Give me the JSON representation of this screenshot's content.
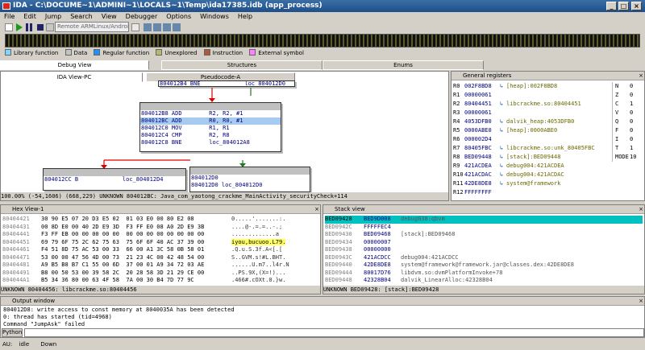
{
  "window": {
    "title": "IDA - C:\\DOCUME~1\\ADMINI~1\\LOCALS~1\\Temp\\ida17385.idb (app_process)"
  },
  "menu": [
    "File",
    "Edit",
    "Jump",
    "Search",
    "View",
    "Debugger",
    "Options",
    "Windows",
    "Help"
  ],
  "toolbar": {
    "debugger": "Remote ARMLinux/Android debugger"
  },
  "legend": [
    {
      "label": "Library function",
      "color": "#7fd7ff"
    },
    {
      "label": "Data",
      "color": "#c4c4c4"
    },
    {
      "label": "Regular function",
      "color": "#1e90ff"
    },
    {
      "label": "Unexplored",
      "color": "#b8b870"
    },
    {
      "label": "Instruction",
      "color": "#b05a3a"
    },
    {
      "label": "External symbol",
      "color": "#ff80ff"
    }
  ],
  "tabs": {
    "debug_view": "Debug View",
    "structures": "Structures",
    "enums": "Enums",
    "ida_view": "IDA View-PC",
    "pseudocode": "Pseudocode-A"
  },
  "graph": {
    "top_node": "804012B4 BNE             loc_804012D0",
    "main_node": [
      "804012B8 ADD        R2, R2, #1",
      "804012BC ADD        R0, R0, #1",
      "804012C0 MOV        R1, R1",
      "804012C4 CMP        R2, R8",
      "804012C8 BNE        loc_804012A8"
    ],
    "left_node": "804012CC B             loc_804012D4",
    "right_node": [
      "804012D0",
      "804012D0 loc_804012D0"
    ],
    "status": "100.00% (-54,1606) (668,229) UNKNOWN 804012BC: Java_com_yaotong_crackme_MainActivity_securityCheck+114"
  },
  "registers": {
    "title": "General registers",
    "rows": [
      {
        "name": "R0",
        "value": "002F8BD8",
        "desc": "[heap]:002F8BD8"
      },
      {
        "name": "R1",
        "value": "00000061",
        "desc": ""
      },
      {
        "name": "R2",
        "value": "80404451",
        "desc": "libcrackme.so:80404451"
      },
      {
        "name": "R3",
        "value": "00000061",
        "desc": ""
      },
      {
        "name": "R4",
        "value": "4053DFB0",
        "desc": "dalvik_heap:4053DFB0"
      },
      {
        "name": "R5",
        "value": "0000ABE0",
        "desc": "[heap]:0000ABE0"
      },
      {
        "name": "R6",
        "value": "000002D4",
        "desc": ""
      },
      {
        "name": "R7",
        "value": "80405FBC",
        "desc": "libcrackme.so:unk_80405FBC"
      },
      {
        "name": "R8",
        "value": "BED09448",
        "desc": "[stack]:BED09448"
      },
      {
        "name": "R9",
        "value": "421ACDEA",
        "desc": "debug004:421ACDEA"
      },
      {
        "name": "R10",
        "value": "421ACDAC",
        "desc": "debug004:421ACDAC"
      },
      {
        "name": "R11",
        "value": "42DE8DE8",
        "desc": "system@framework"
      },
      {
        "name": "R12",
        "value": "FFFFFFFF",
        "desc": ""
      }
    ],
    "flags": [
      {
        "name": "N",
        "value": "0"
      },
      {
        "name": "Z",
        "value": "0"
      },
      {
        "name": "C",
        "value": "1"
      },
      {
        "name": "V",
        "value": "0"
      },
      {
        "name": "Q",
        "value": "0"
      },
      {
        "name": "F",
        "value": "0"
      },
      {
        "name": "I",
        "value": "0"
      },
      {
        "name": "T",
        "value": "1"
      },
      {
        "name": "MODE",
        "value": "10"
      }
    ]
  },
  "hex": {
    "title": "Hex View-1",
    "rows": [
      {
        "addr": "80404421",
        "bytes": "30 90 E5 07 20 D3 E5 02  01 03 E0 00 80 E2 08",
        "ascii": "0.....'.......:."
      },
      {
        "addr": "80404431",
        "bytes": "00 8D E0 00 40 2D E9 3D  F3 FF E0 08 A0 2D E9 3B",
        "ascii": "....@-.=.=..-.;"
      },
      {
        "addr": "80404441",
        "bytes": "F3 FF EB 00 00 00 00 00  00 00 00 00 00 00 00 00",
        "ascii": ".............a"
      },
      {
        "addr": "80404451",
        "bytes": "69 79 6F 75 2C 62 75 63  75 6F 6F 40 AC 37 39 00",
        "ascii": "iyou,bucuoo.L79.",
        "hl": true
      },
      {
        "addr": "80404461",
        "bytes": "F4 51 8D 75 AC 53 00 33  66 00 A1 3C 58 0B 58 01",
        "ascii": ".Q.u.S.3f.A<[.["
      },
      {
        "addr": "80404471",
        "bytes": "53 00 00 47 56 4D 00 73  21 23 4C 00 42 48 54 00",
        "ascii": "S..GVM.s!#L.BHT."
      },
      {
        "addr": "80404481",
        "bytes": "A9 B5 B8 B7 C1 55 00 6D  37 00 01 A9 34 72 03 AE",
        "ascii": "......U.m7..l4r.N"
      },
      {
        "addr": "80404491",
        "bytes": "B8 00 50 53 00 39 58 2C  20 28 58 3D 21 29 CE 00",
        "ascii": "..PS.9X,(X=!)..."
      },
      {
        "addr": "804044A1",
        "bytes": "B5 34 36 80 00 63 4F 58  7A 00 30 B4 7D 77 9C",
        "ascii": ".466#.cOXt.0.}w."
      }
    ],
    "status": "UNKNOWN 80404456: libcrackme.so:80404456"
  },
  "stack": {
    "title": "Stack view",
    "rows": [
      {
        "addr": "BED09428",
        "value": "BED9D008",
        "desc": "debug038:qbvm",
        "hl": true
      },
      {
        "addr": "BED0942C",
        "value": "FFFFFEC4",
        "desc": ""
      },
      {
        "addr": "BED09430",
        "value": "BED09468",
        "desc": "[stack]:BED09468"
      },
      {
        "addr": "BED09434",
        "value": "00000007",
        "desc": ""
      },
      {
        "addr": "BED09438",
        "value": "00000000",
        "desc": ""
      },
      {
        "addr": "BED0943C",
        "value": "421ACDCC",
        "desc": "debug004:421ACDCC"
      },
      {
        "addr": "BED09440",
        "value": "42DE8DE8",
        "desc": "system@framework@framework.jar@classes.dex:42DE8DE8"
      },
      {
        "addr": "BED09444",
        "value": "80017D76",
        "desc": "libdvm.so:dvmPlatformInvoke+78"
      },
      {
        "addr": "BED09448",
        "value": "42328B04",
        "desc": "dalvik_LinearAlloc:42328B04"
      }
    ],
    "status": "UNKNOWN BED09428: [stack]:BED09428"
  },
  "output": {
    "title": "Output window",
    "lines": [
      "804012D8: write access to const memory at 8040035A has been detected",
      "0: thread has started (tid=4968)",
      "Command \"JumpAsk\" failed"
    ],
    "python_label": "Python"
  },
  "statusbar": {
    "au": "AU:",
    "state": "idle",
    "direction": "Down"
  }
}
